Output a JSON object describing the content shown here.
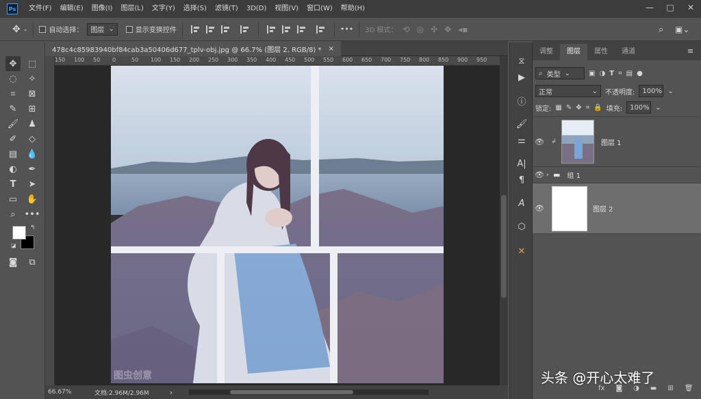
{
  "menubar": {
    "logo": "Ps",
    "items": [
      "文件(F)",
      "编辑(E)",
      "图像(I)",
      "图层(L)",
      "文字(Y)",
      "选择(S)",
      "滤镜(T)",
      "3D(D)",
      "视图(V)",
      "窗口(W)",
      "帮助(H)"
    ]
  },
  "options": {
    "auto_select_label": "自动选择：",
    "auto_select_value": "图层",
    "show_transform_label": "显示变换控件",
    "more": "•••",
    "mode_3d_label": "3D 模式："
  },
  "document": {
    "tab_title": "478c4c85983940bf84cab3a50406d677_tplv-obj.jpg @ 66.7% (图层 2, RGB/8) *",
    "close": "×",
    "ruler_ticks": [
      "150",
      "100",
      "50",
      "0",
      "50",
      "100",
      "150",
      "200",
      "250",
      "300",
      "350",
      "400",
      "450",
      "500",
      "550",
      "600",
      "650",
      "700",
      "750",
      "800",
      "850",
      "900",
      "950"
    ],
    "image_watermark": "图虫创意"
  },
  "status": {
    "zoom": "66.67%",
    "doc_info": "文档:2.96M/2.96M",
    "arrow": "›"
  },
  "panel": {
    "tabs": [
      "调整",
      "图层",
      "属性",
      "通道"
    ],
    "active_tab": "图层",
    "kind_filter": "类型",
    "blend_mode": "正常",
    "opacity_label": "不透明度:",
    "opacity_value": "100%",
    "lock_label": "锁定:",
    "fill_label": "填充:",
    "fill_value": "100%",
    "layers": [
      {
        "name": "图层 1"
      },
      {
        "name": "组 1"
      },
      {
        "name": "图层 2"
      }
    ],
    "fx_label": "fx"
  },
  "overlay_watermark": "头条 @开心太难了",
  "colors": {
    "photo_sky": "#dce7f0",
    "photo_sea": "#8fa3ba",
    "photo_rock": "#7a6f84",
    "grid_line": "#ffffff",
    "accent_tool": "#e0a040"
  }
}
